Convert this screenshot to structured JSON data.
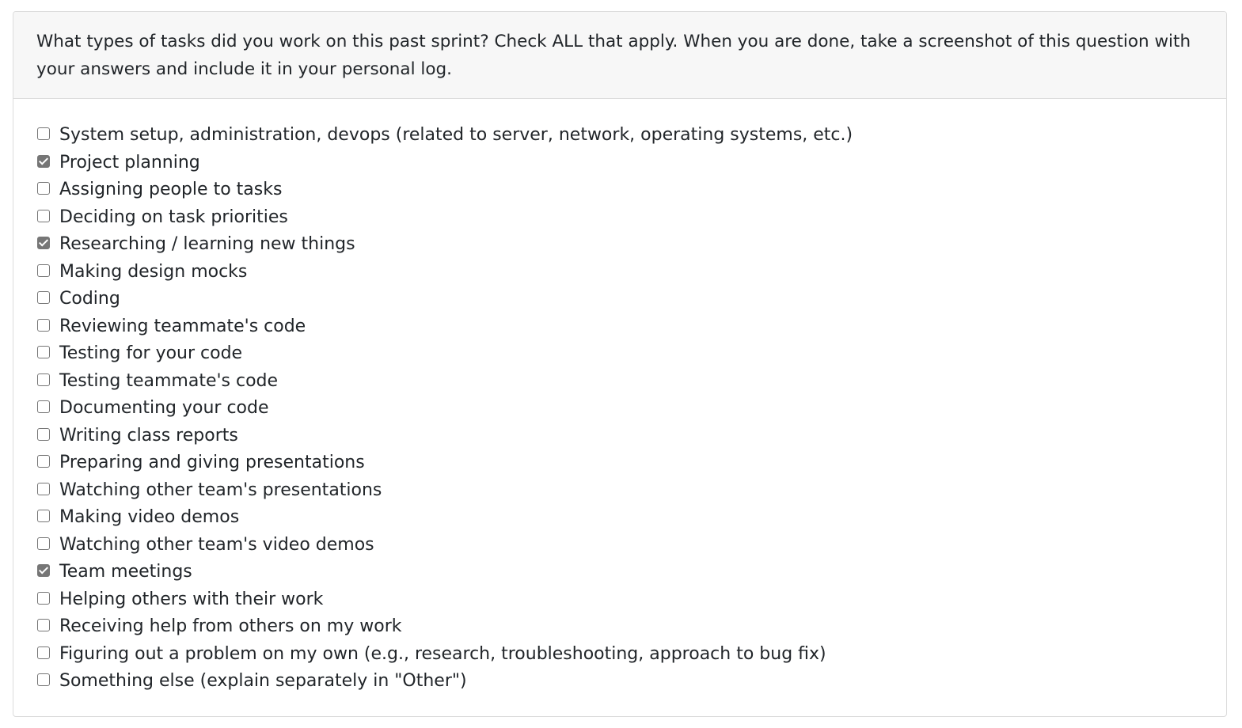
{
  "question": {
    "prompt": "What types of tasks did you work on this past sprint? Check ALL that apply. When you are done, take a screenshot of this question with your answers and include it in your personal log."
  },
  "options": [
    {
      "label": "System setup, administration, devops (related to server, network, operating systems, etc.)",
      "checked": false
    },
    {
      "label": "Project planning",
      "checked": true
    },
    {
      "label": "Assigning people to tasks",
      "checked": false
    },
    {
      "label": "Deciding on task priorities",
      "checked": false
    },
    {
      "label": "Researching / learning new things",
      "checked": true
    },
    {
      "label": "Making design mocks",
      "checked": false
    },
    {
      "label": "Coding",
      "checked": false
    },
    {
      "label": "Reviewing teammate's code",
      "checked": false
    },
    {
      "label": "Testing for your code",
      "checked": false
    },
    {
      "label": "Testing teammate's code",
      "checked": false
    },
    {
      "label": "Documenting your code",
      "checked": false
    },
    {
      "label": "Writing class reports",
      "checked": false
    },
    {
      "label": "Preparing and giving presentations",
      "checked": false
    },
    {
      "label": "Watching other team's presentations",
      "checked": false
    },
    {
      "label": "Making video demos",
      "checked": false
    },
    {
      "label": "Watching other team's video demos",
      "checked": false
    },
    {
      "label": "Team meetings",
      "checked": true
    },
    {
      "label": "Helping others with their work",
      "checked": false
    },
    {
      "label": "Receiving help from others on my work",
      "checked": false
    },
    {
      "label": "Figuring out a problem on my own (e.g., research, troubleshooting, approach to bug fix)",
      "checked": false
    },
    {
      "label": "Something else (explain separately in \"Other\")",
      "checked": false
    }
  ],
  "colors": {
    "header_bg": "#f7f7f7",
    "border": "#dcdcdc",
    "text": "#212529",
    "checkbox_checked": "#767676"
  }
}
